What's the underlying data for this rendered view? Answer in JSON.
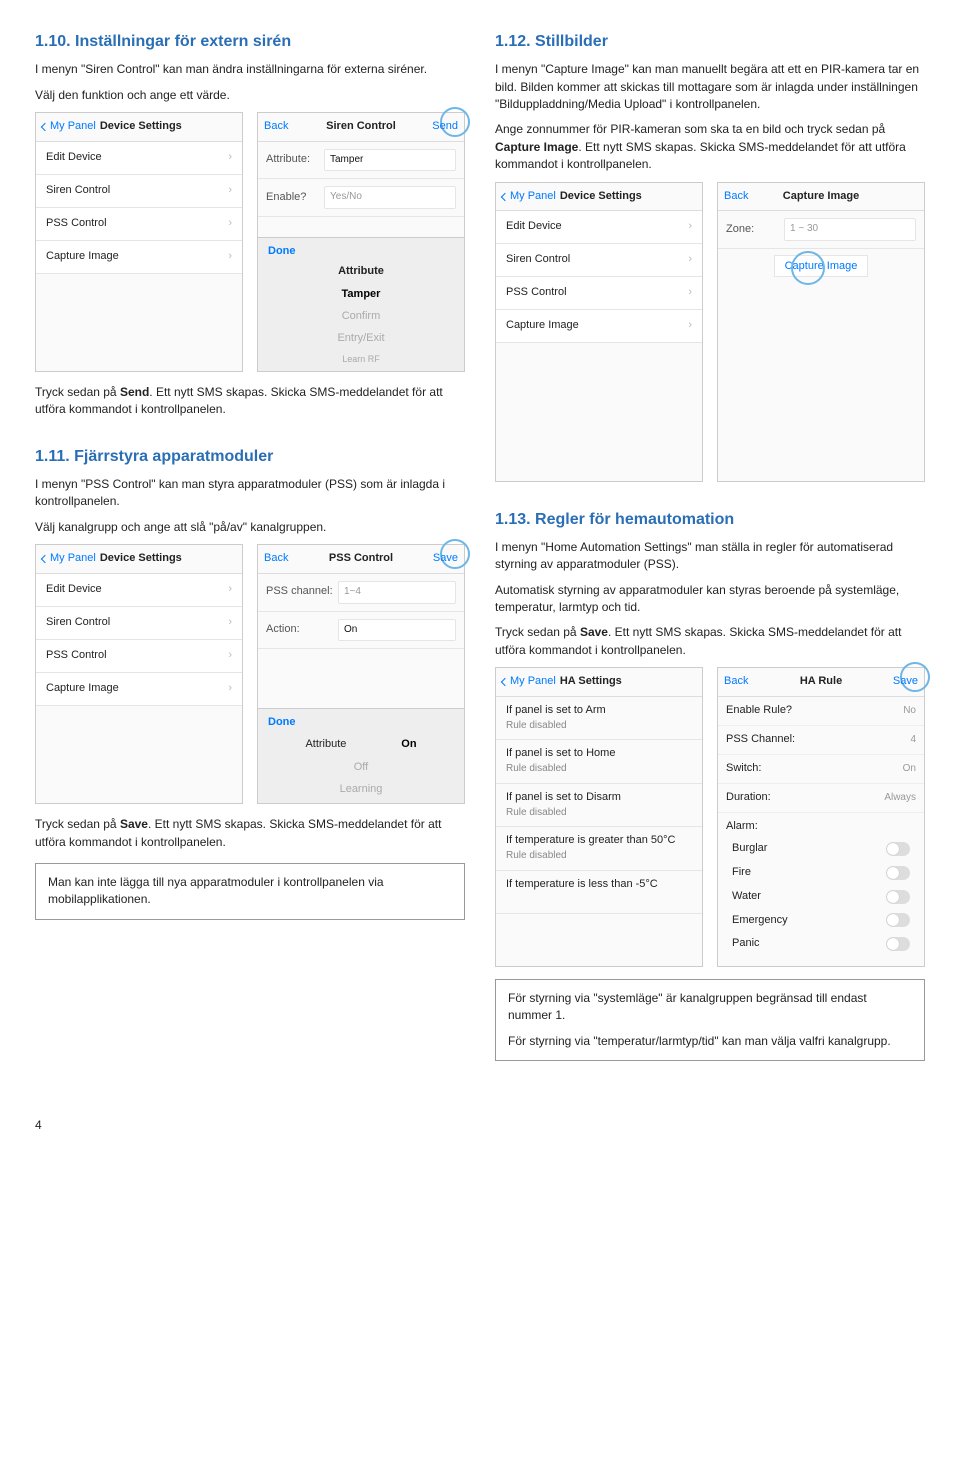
{
  "page_number": "4",
  "s110": {
    "title": "1.10. Inställningar för extern sirén",
    "p1": "I menyn \"Siren Control\" kan man ändra inställningarna för externa siréner.",
    "p2": "Välj den funktion och ange ett värde.",
    "after": "Tryck sedan på Send. Ett nytt SMS skapas. Skicka SMS-meddelandet för att utföra kommandot i kontrollpanelen.",
    "after_bold": "Send",
    "left_phone": {
      "back": "My Panel",
      "title": "Device Settings",
      "items": [
        "Edit Device",
        "Siren Control",
        "PSS Control",
        "Capture Image"
      ]
    },
    "right_phone": {
      "back": "Back",
      "title": "Siren Control",
      "send": "Send",
      "attr_label": "Attribute:",
      "attr_val": "Tamper",
      "enable_label": "Enable?",
      "enable_val": "Yes/No",
      "kbd_done": "Done",
      "kbd_title": "Attribute",
      "kbd_opts": [
        "Tamper",
        "Confirm",
        "Entry/Exit",
        "Learn RF"
      ]
    }
  },
  "s111": {
    "title": "1.11. Fjärrstyra apparatmoduler",
    "p1": "I menyn \"PSS Control\" kan man styra apparatmoduler (PSS) som är inlagda i kontrollpanelen.",
    "p2": "Välj kanalgrupp och ange att slå \"på/av\" kanalgruppen.",
    "after": "Tryck sedan på Save. Ett nytt SMS skapas. Skicka SMS-meddelandet för att utföra kommandot i kontrollpanelen.",
    "after_bold": "Save",
    "note": "Man kan inte lägga till nya apparatmoduler i kontrollpanelen via mobilapplikationen.",
    "left_phone": {
      "back": "My Panel",
      "title": "Device Settings",
      "items": [
        "Edit Device",
        "Siren Control",
        "PSS Control",
        "Capture Image"
      ]
    },
    "right_phone": {
      "back": "Back",
      "title": "PSS Control",
      "save": "Save",
      "ch_label": "PSS channel:",
      "ch_val": "1~4",
      "act_label": "Action:",
      "act_val": "On",
      "kbd_done": "Done",
      "kbd_title_l": "Attribute",
      "kbd_title_r": "On",
      "kbd_opts": [
        "Off",
        "Learning"
      ]
    }
  },
  "s112": {
    "title": "1.12. Stillbilder",
    "p1": "I menyn \"Capture Image\" kan man manuellt begära att ett en PIR-kamera tar en bild. Bilden kommer att skickas till mottagare som är inlagda under inställningen \"Bilduppladdning/Media Upload\" i kontrollpanelen.",
    "p2a": "Ange zonnummer för PIR-kameran som ska ta en bild och tryck sedan på ",
    "p2b": "Capture Image",
    "p2c": ". Ett nytt SMS skapas. Skicka SMS-meddelandet för att utföra kommandot i kontrollpanelen.",
    "left_phone": {
      "back": "My Panel",
      "title": "Device Settings",
      "items": [
        "Edit Device",
        "Siren Control",
        "PSS Control",
        "Capture Image"
      ]
    },
    "right_phone": {
      "back": "Back",
      "title": "Capture Image",
      "zone_label": "Zone:",
      "zone_val": "1 ~ 30",
      "btn": "Capture Image"
    }
  },
  "s113": {
    "title": "1.13. Regler för hemautomation",
    "p1": "I menyn \"Home Automation Settings\" man ställa in regler för automatiserad styrning av apparatmoduler (PSS).",
    "p2": "Automatisk styrning av apparatmoduler kan styras beroende på systemläge, temperatur, larmtyp och tid.",
    "p3": "Tryck sedan på Save. Ett nytt SMS skapas. Skicka SMS-meddelandet för att utföra kommandot i kontrollpanelen.",
    "p3_bold": "Save",
    "note1": "För styrning via \"systemläge\" är kanalgruppen begränsad till endast nummer 1.",
    "note2": "För styrning via \"temperatur/larmtyp/tid\" kan man välja valfri kanalgrupp.",
    "left_phone": {
      "back": "My Panel",
      "title": "HA Settings",
      "rules": [
        {
          "t": "If panel is set to Arm",
          "s": "Rule disabled"
        },
        {
          "t": "If panel is set to Home",
          "s": "Rule disabled"
        },
        {
          "t": "If panel is set to Disarm",
          "s": "Rule disabled"
        },
        {
          "t": "If temperature is greater than 50°C",
          "s": "Rule disabled"
        },
        {
          "t": "If temperature is less than -5°C",
          "s": ""
        }
      ]
    },
    "right_phone": {
      "back": "Back",
      "title": "HA Rule",
      "save": "Save",
      "fields": [
        {
          "l": "Enable Rule?",
          "v": "No"
        },
        {
          "l": "PSS Channel:",
          "v": "4"
        },
        {
          "l": "Switch:",
          "v": "On"
        },
        {
          "l": "Duration:",
          "v": "Always"
        }
      ],
      "alarm_label": "Alarm:",
      "alarms": [
        "Burglar",
        "Fire",
        "Water",
        "Emergency",
        "Panic"
      ]
    }
  }
}
